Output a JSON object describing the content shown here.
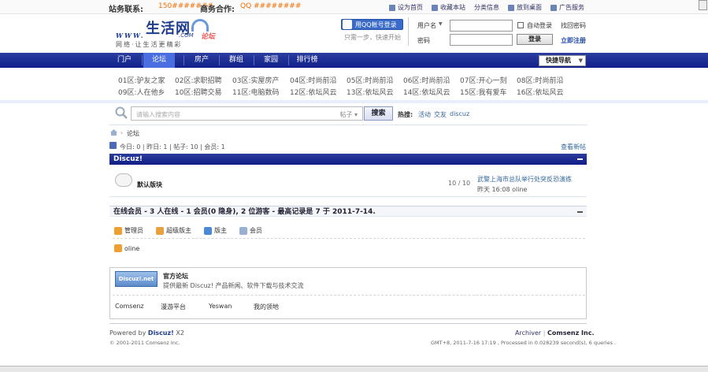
{
  "topbar": {
    "station_contact_label": "站务联系:",
    "station_contact_value": "150#######",
    "business_label": "商务合作:",
    "business_value": "QQ ########",
    "links": [
      "设为首页",
      "收藏本站",
      "分类信息",
      "放到桌面",
      "广告服务"
    ]
  },
  "logo": {
    "name": "生活网",
    "www": "WWW.",
    "com": ".COM",
    "forum_tag": "论坛",
    "slogan": "网络·让生活更精彩"
  },
  "login": {
    "qq_button": "用QQ帐号登录",
    "qq_hint": "只需一步，快速开始",
    "username_label": "用户名",
    "password_label": "密码",
    "auto_login": "自动登录",
    "find_password": "找回密码",
    "login_button": "登录",
    "register": "立即注册"
  },
  "nav": {
    "items": [
      "门户",
      "论坛",
      "房产",
      "群组",
      "家园",
      "排行榜"
    ],
    "active": "论坛",
    "quick_nav": "快捷导航"
  },
  "zones": [
    "01区:驴友之家",
    "02区:求职招聘",
    "03区:实屋房产",
    "04区:时尚前沿",
    "05区:时尚前沿",
    "06区:时尚前沿",
    "07区:开心一刻",
    "08区:时尚前沿",
    "09区:人在他乡",
    "10区:招聘交易",
    "11区:电脑数码",
    "12区:依坛风云",
    "13区:依坛风云",
    "14区:依坛风云",
    "15区:我有爱车",
    "16区:依坛风云"
  ],
  "search": {
    "placeholder": "请输入搜索内容",
    "type": "帖子",
    "button": "搜索",
    "hot_label": "热搜:",
    "hot_items": [
      "活动",
      "交友",
      "discuz"
    ]
  },
  "breadcrumb": "论坛",
  "stats": {
    "text": "今日: 0 | 昨日: 1 | 帖子: 10 | 会员: 1",
    "newest": "查看新帖"
  },
  "discuz_panel": {
    "title": "Discuz!",
    "forum_name": "默认版块",
    "count": "10 / 10",
    "last_post_title": "武警上海市总队举行处突反恐演练",
    "last_post_meta": "昨天 16:08 oline"
  },
  "online": {
    "title": "在线会员 - 3 人在线 - 1 会员(0 隐身), 2 位游客 - 最高记录是 7 于 2011-7-14.",
    "legend": [
      {
        "label": "管理员",
        "color": "#f0a030"
      },
      {
        "label": "超级版主",
        "color": "#e8a040"
      },
      {
        "label": "版主",
        "color": "#4a8ad8"
      },
      {
        "label": "会员",
        "color": "#9ab0d0"
      }
    ],
    "users": [
      "oline"
    ]
  },
  "partner": {
    "badge": "Discuz!.net",
    "name": "官方论坛",
    "desc": "提供最新 Discuz! 产品新闻、软件下载与技术交流",
    "links": [
      "Comsenz",
      "漫游平台",
      "Yeswan",
      "我的领地"
    ]
  },
  "footer": {
    "powered_prefix": "Powered by",
    "powered_brand": "Discuz!",
    "powered_version": "X2",
    "copyright": "© 2001-2011 Comsenz Inc.",
    "archiver": "Archiver",
    "company": "Comsenz Inc.",
    "gmt": "GMT+8, 2011-7-16 17:19 , Processed in 0.028239 second(s), 6 queries ."
  }
}
